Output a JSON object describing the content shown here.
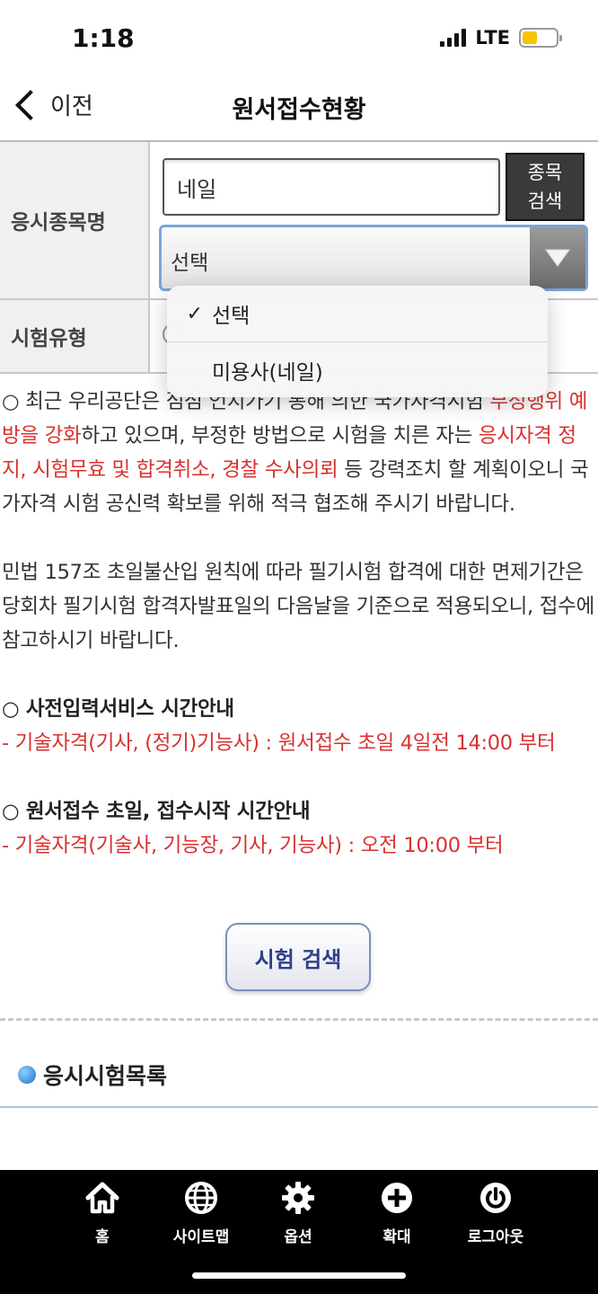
{
  "status": {
    "time": "1:18",
    "network": "LTE"
  },
  "nav": {
    "back_label": "이전",
    "title": "원서접수현황"
  },
  "form": {
    "subject_label": "응시종목명",
    "subject_value": "네일",
    "search_button_line1": "종목",
    "search_button_line2": "검색",
    "select_value": "선택",
    "exam_type_label": "시험유형"
  },
  "dropdown": {
    "options": [
      {
        "label": "선택",
        "selected": true
      },
      {
        "label": "미용사(네일)",
        "selected": false
      }
    ]
  },
  "notice": {
    "p1_a": "○ 최근 우리공단은 점점 언지가기 통해 의한 국가자격시험 ",
    "p1_b": "부정행위 예방을 강화",
    "p1_c": "하고 있으며, 부정한 방법으로 시험을 치른 자는 ",
    "p1_d": "응시자격 정지, 시험무효 및 합격취소, 경찰 수사의뢰",
    "p1_e": " 등 강력조치 할 계획이오니 국가자격 시험 공신력 확보를 위해 적극 협조해 주시기 바랍니다.",
    "p2": "민법 157조 초일불산입 원칙에 따라 필기시험 합격에 대한 면제기간은 당회차 필기시험 합격자발표일의 다음날을 기준으로 적용되오니, 접수에 참고하시기 바랍니다.",
    "p3_title": "○ 사전입력서비스 시간안내",
    "p3_body": "- 기술자격(기사, (정기)기능사) : 원서접수 초일 4일전 14:00 부터",
    "p4_title": "○ 원서접수 초일, 접수시작 시간안내",
    "p4_body": "- 기술자격(기술사, 기능장, 기사, 기능사) : 오전 10:00 부터"
  },
  "exam_search_label": "시험 검색",
  "section_title": "응시시험목록",
  "tabbar": {
    "home": "홈",
    "sitemap": "사이트맵",
    "options": "옵션",
    "zoom": "확대",
    "logout": "로그아웃"
  },
  "colors": {
    "accent_red": "#d8322f",
    "battery": "#f5c400",
    "button_text": "#2d3f8a"
  }
}
